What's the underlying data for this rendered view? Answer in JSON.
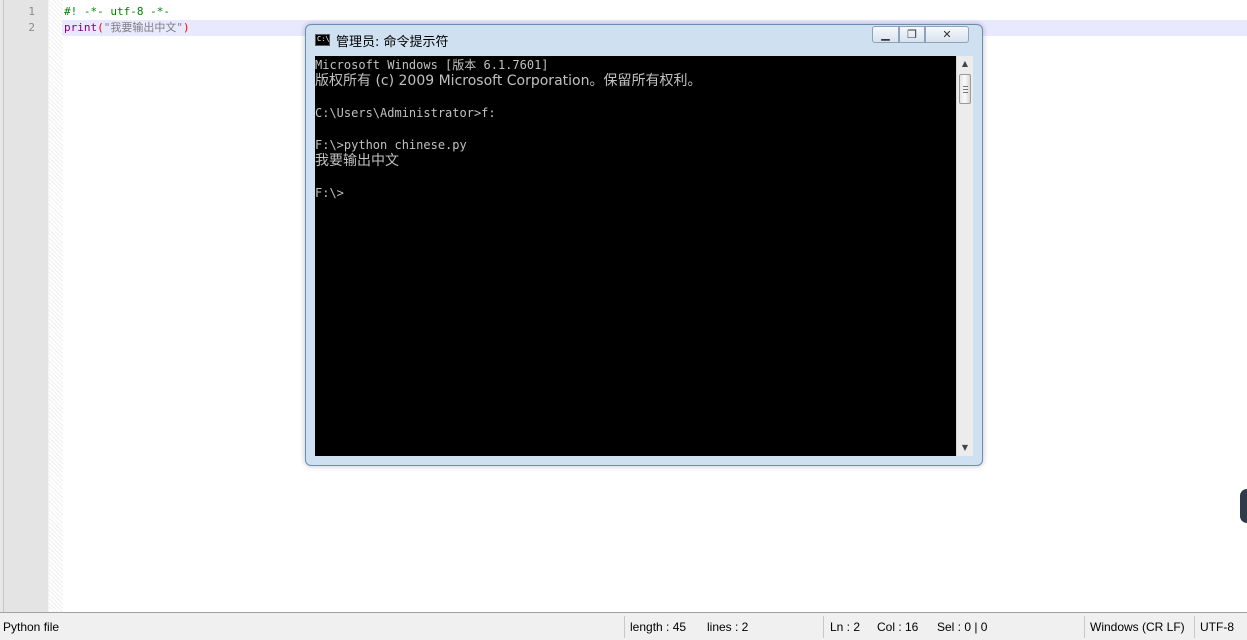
{
  "editor": {
    "line_numbers": [
      "1",
      "2"
    ],
    "lines": [
      {
        "comment": "#! -*- utf-8 -*-"
      },
      {
        "keyword": "print",
        "open": "(",
        "string": "\"我要输出中文\"",
        "close": ")"
      }
    ]
  },
  "console": {
    "title": "管理员: 命令提示符",
    "icon": "cmd-icon",
    "icon_text": "C:\\",
    "buttons": {
      "minimize": "minimize-icon",
      "maximize": "maximize-icon",
      "close": "close-icon"
    },
    "lines": [
      "Microsoft Windows [版本 6.1.7601]",
      "版权所有 (c) 2009 Microsoft Corporation。保留所有权利。",
      "",
      "C:\\Users\\Administrator>f:",
      "",
      "F:\\>python chinese.py",
      "我要输出中文",
      "",
      "F:\\>"
    ]
  },
  "statusbar": {
    "file_type": "Python file",
    "length": "length : 45",
    "lines": "lines : 2",
    "ln": "Ln : 2",
    "col": "Col : 16",
    "sel": "Sel : 0 | 0",
    "eol": "Windows (CR LF)",
    "encoding": "UTF-8"
  },
  "colors": {
    "comment": "#008000",
    "keyword": "#800080",
    "string": "#808080",
    "paren": "#ff0000",
    "caret_line": "#e8e8ff",
    "console_bg": "#000000",
    "console_text": "#c0c0c0"
  }
}
